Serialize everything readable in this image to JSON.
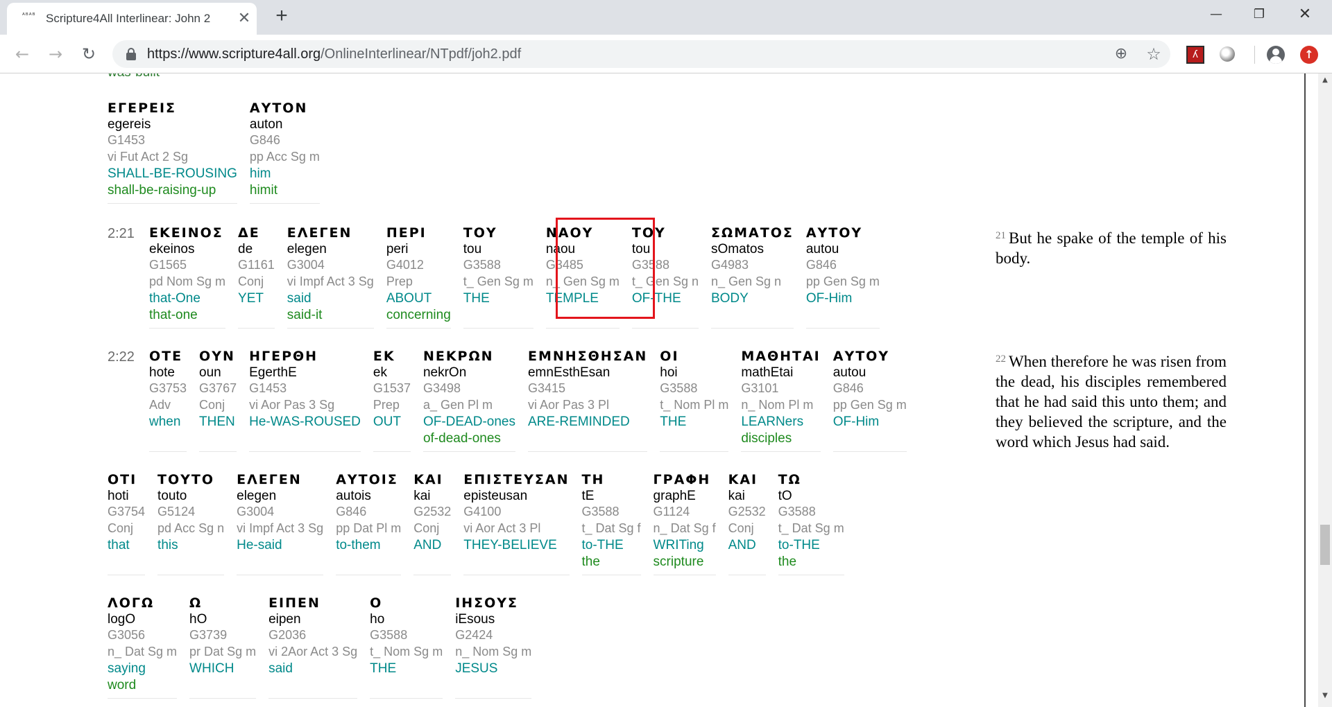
{
  "browser": {
    "tab_title": "Scripture4All Interlinear: John 2",
    "favicon_text": "ᴬᴮᴬᴮ",
    "close_glyph": "✕",
    "new_tab_glyph": "+",
    "url_host": "https://www.scripture4all.org",
    "url_path": "/OnlineInterlinear/NTpdf/joh2.pdf",
    "window_controls": {
      "minimize": "—",
      "maximize": "❐",
      "close": "✕"
    },
    "icons": [
      "back-arrow-icon",
      "forward-arrow-icon",
      "reload-icon",
      "lock-icon",
      "zoom-icon",
      "star-icon",
      "acrobat-icon",
      "extension-icon",
      "account-icon",
      "update-icon"
    ]
  },
  "page": {
    "cut_off_word": "was-built",
    "highlight_color": "#e3151c",
    "rows": [
      {
        "verse": "",
        "words": [
          {
            "greek": "ΕΓΕΡΕΙΣ",
            "translit": "egereis",
            "strong": "G1453",
            "grammar": "vi Fut Act 2 Sg",
            "eng": "SHALL-BE-ROUSING",
            "eng2": "shall-be-raising-up"
          },
          {
            "greek": "ΑΥΤΟΝ",
            "translit": "auton",
            "strong": "G846",
            "grammar": "pp Acc Sg m",
            "eng": "him",
            "eng2": "himit"
          }
        ]
      },
      {
        "verse": "2:21",
        "words": [
          {
            "greek": "ΕΚΕΙΝΟΣ",
            "translit": "ekeinos",
            "strong": "G1565",
            "grammar": "pd Nom Sg m",
            "eng": "that-One",
            "eng2": "that-one"
          },
          {
            "greek": "ΔΕ",
            "translit": "de",
            "strong": "G1161",
            "grammar": "Conj",
            "eng": "YET",
            "eng2": ""
          },
          {
            "greek": "ΕΛΕΓΕΝ",
            "translit": "elegen",
            "strong": "G3004",
            "grammar": "vi Impf Act 3 Sg",
            "eng": "said",
            "eng2": "said-it"
          },
          {
            "greek": "ΠΕΡΙ",
            "translit": "peri",
            "strong": "G4012",
            "grammar": "Prep",
            "eng": "ABOUT",
            "eng2": "concerning"
          },
          {
            "greek": "ΤΟΥ",
            "translit": "tou",
            "strong": "G3588",
            "grammar": "t_ Gen Sg m",
            "eng": "THE",
            "eng2": ""
          },
          {
            "greek": "ΝΑΟΥ",
            "translit": "naou",
            "strong": "G3485",
            "grammar": "n_ Gen Sg m",
            "eng": "TEMPLE",
            "eng2": ""
          },
          {
            "greek": "ΤΟΥ",
            "translit": "tou",
            "strong": "G3588",
            "grammar": "t_ Gen Sg n",
            "eng": "OF-THE",
            "eng2": ""
          },
          {
            "greek": "ΣΩΜΑΤΟΣ",
            "translit": "sOmatos",
            "strong": "G4983",
            "grammar": "n_ Gen Sg n",
            "eng": "BODY",
            "eng2": ""
          },
          {
            "greek": "ΑΥΤΟΥ",
            "translit": "autou",
            "strong": "G846",
            "grammar": "pp Gen Sg m",
            "eng": "OF-Him",
            "eng2": ""
          }
        ]
      },
      {
        "verse": "2:22",
        "words": [
          {
            "greek": "ΟΤΕ",
            "translit": "hote",
            "strong": "G3753",
            "grammar": "Adv",
            "eng": "when",
            "eng2": ""
          },
          {
            "greek": "ΟΥΝ",
            "translit": "oun",
            "strong": "G3767",
            "grammar": "Conj",
            "eng": "THEN",
            "eng2": ""
          },
          {
            "greek": "ΗΓΕΡΘΗ",
            "translit": "EgerthE",
            "strong": "G1453",
            "grammar": "vi Aor Pas 3 Sg",
            "eng": "He-WAS-ROUSED",
            "eng2": ""
          },
          {
            "greek": "ΕΚ",
            "translit": "ek",
            "strong": "G1537",
            "grammar": "Prep",
            "eng": "OUT",
            "eng2": ""
          },
          {
            "greek": "ΝΕΚΡΩΝ",
            "translit": "nekrOn",
            "strong": "G3498",
            "grammar": "a_ Gen Pl m",
            "eng": "OF-DEAD-ones",
            "eng2": "of-dead-ones"
          },
          {
            "greek": "ΕΜΝΗΣΘΗΣΑΝ",
            "translit": "emnEsthEsan",
            "strong": "G3415",
            "grammar": "vi Aor Pas 3 Pl",
            "eng": "ARE-REMINDED",
            "eng2": ""
          },
          {
            "greek": "ΟΙ",
            "translit": "hoi",
            "strong": "G3588",
            "grammar": "t_ Nom Pl m",
            "eng": "THE",
            "eng2": ""
          },
          {
            "greek": "ΜΑΘΗΤΑΙ",
            "translit": "mathEtai",
            "strong": "G3101",
            "grammar": "n_ Nom Pl m",
            "eng": "LEARNers",
            "eng2": "disciples"
          },
          {
            "greek": "ΑΥΤΟΥ",
            "translit": "autou",
            "strong": "G846",
            "grammar": "pp Gen Sg m",
            "eng": "OF-Him",
            "eng2": ""
          }
        ]
      },
      {
        "verse": "",
        "words": [
          {
            "greek": "ΟΤΙ",
            "translit": "hoti",
            "strong": "G3754",
            "grammar": "Conj",
            "eng": "that",
            "eng2": ""
          },
          {
            "greek": "ΤΟΥΤΟ",
            "translit": "touto",
            "strong": "G5124",
            "grammar": "pd Acc Sg n",
            "eng": "this",
            "eng2": ""
          },
          {
            "greek": "ΕΛΕΓΕΝ",
            "translit": "elegen",
            "strong": "G3004",
            "grammar": "vi Impf Act 3 Sg",
            "eng": "He-said",
            "eng2": ""
          },
          {
            "greek": "ΑΥΤΟΙΣ",
            "translit": "autois",
            "strong": "G846",
            "grammar": "pp Dat Pl m",
            "eng": "to-them",
            "eng2": ""
          },
          {
            "greek": "ΚΑΙ",
            "translit": "kai",
            "strong": "G2532",
            "grammar": "Conj",
            "eng": "AND",
            "eng2": ""
          },
          {
            "greek": "ΕΠΙΣΤΕΥΣΑΝ",
            "translit": "episteusan",
            "strong": "G4100",
            "grammar": "vi Aor Act 3 Pl",
            "eng": "THEY-BELIEVE",
            "eng2": ""
          },
          {
            "greek": "ΤΗ",
            "translit": "tE",
            "strong": "G3588",
            "grammar": "t_ Dat Sg f",
            "eng": "to-THE",
            "eng2": "the"
          },
          {
            "greek": "ΓΡΑΦΗ",
            "translit": "graphE",
            "strong": "G1124",
            "grammar": "n_ Dat Sg f",
            "eng": "WRITing",
            "eng2": "scripture"
          },
          {
            "greek": "ΚΑΙ",
            "translit": "kai",
            "strong": "G2532",
            "grammar": "Conj",
            "eng": "AND",
            "eng2": ""
          },
          {
            "greek": "ΤΩ",
            "translit": "tO",
            "strong": "G3588",
            "grammar": "t_ Dat Sg m",
            "eng": "to-THE",
            "eng2": "the"
          }
        ]
      },
      {
        "verse": "",
        "words": [
          {
            "greek": "ΛΟΓΩ",
            "translit": "logO",
            "strong": "G3056",
            "grammar": "n_ Dat Sg m",
            "eng": "saying",
            "eng2": "word"
          },
          {
            "greek": "Ω",
            "translit": "hO",
            "strong": "G3739",
            "grammar": "pr Dat Sg m",
            "eng": "WHICH",
            "eng2": ""
          },
          {
            "greek": "ΕΙΠΕΝ",
            "translit": "eipen",
            "strong": "G2036",
            "grammar": "vi 2Aor Act 3 Sg",
            "eng": "said",
            "eng2": ""
          },
          {
            "greek": "Ο",
            "translit": "ho",
            "strong": "G3588",
            "grammar": "t_ Nom Sg m",
            "eng": "THE",
            "eng2": ""
          },
          {
            "greek": "ΙΗΣΟΥΣ",
            "translit": "iEsous",
            "strong": "G2424",
            "grammar": "n_ Nom Sg m",
            "eng": "JESUS",
            "eng2": ""
          }
        ]
      }
    ],
    "kjv": [
      {
        "num": "21",
        "text": "But he spake of the temple of his body."
      },
      {
        "num": "22",
        "text": "When therefore he was risen from the dead, his disciples remembered that he had said this unto them; and they believed the scripture, and the word which Jesus had said."
      }
    ]
  }
}
